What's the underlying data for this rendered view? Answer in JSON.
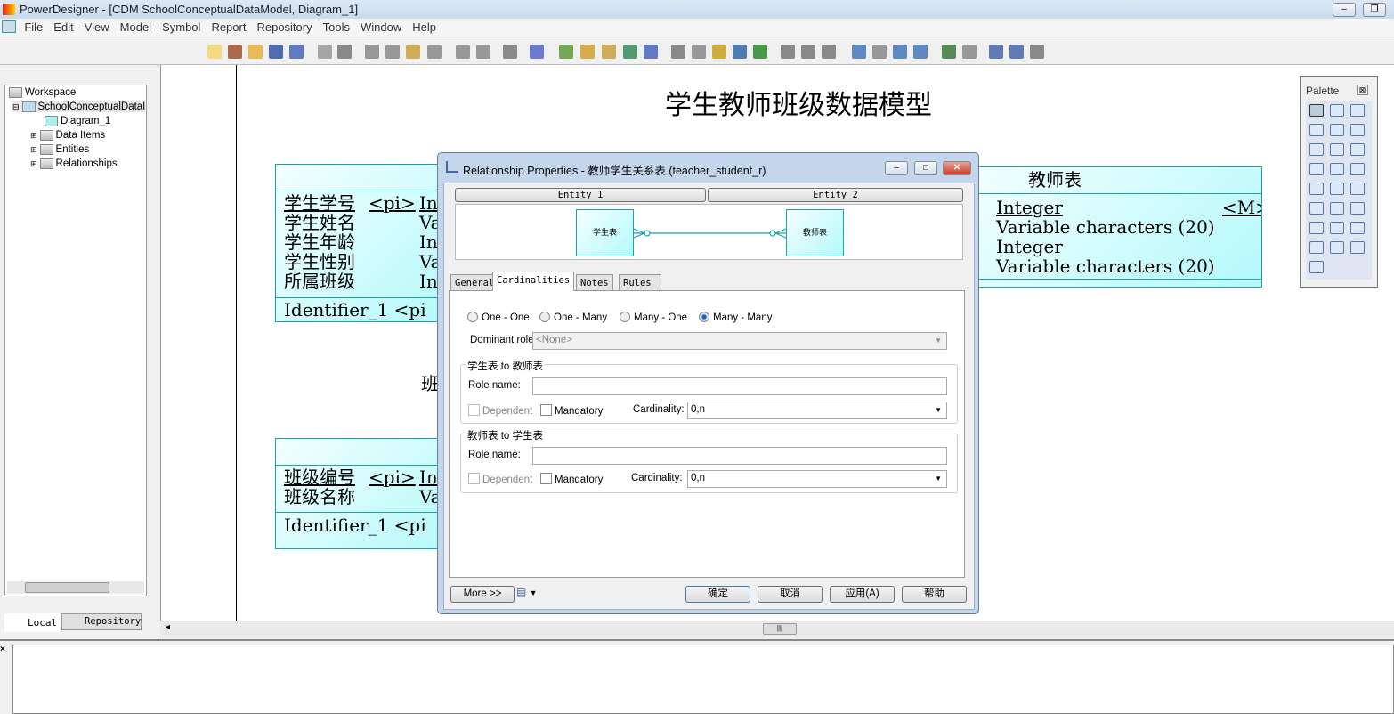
{
  "window": {
    "title": "PowerDesigner - [CDM SchoolConceptualDataModel, Diagram_1]"
  },
  "menu": [
    "File",
    "Edit",
    "View",
    "Model",
    "Symbol",
    "Report",
    "Repository",
    "Tools",
    "Window",
    "Help"
  ],
  "browser": {
    "tree": [
      {
        "label": "Workspace"
      },
      {
        "label": "SchoolConceptualDataI"
      },
      {
        "label": "Diagram_1"
      },
      {
        "label": "Data Items"
      },
      {
        "label": "Entities"
      },
      {
        "label": "Relationships"
      }
    ],
    "tabs": [
      "Local",
      "Repository"
    ]
  },
  "diagram": {
    "title": "学生教师班级数据模型",
    "student": {
      "attrs": [
        {
          "name": "学生学号",
          "pi": "<pi>",
          "type": "In"
        },
        {
          "name": "学生姓名",
          "type": "Va"
        },
        {
          "name": "学生年龄",
          "type": "In"
        },
        {
          "name": "学生性别",
          "type": "Va"
        },
        {
          "name": "所属班级",
          "type": "In"
        }
      ],
      "identifier": "Identifier_1 <pi"
    },
    "class": {
      "attrs": [
        {
          "name": "班级编号",
          "pi": "<pi>",
          "type": "In"
        },
        {
          "name": "班级名称",
          "type": "Va"
        }
      ],
      "identifier": "Identifier_1 <pi"
    },
    "class_rel_label": "班",
    "teacher": {
      "title": "教师表",
      "types": [
        "Integer",
        "Variable characters (20)",
        "Integer",
        "Variable characters (20)"
      ],
      "mandatory": "<M>"
    }
  },
  "palette": {
    "title": "Palette"
  },
  "dialog": {
    "title": "Relationship Properties - 教师学生关系表 (teacher_student_r)",
    "entity1_btn": "Entity 1",
    "entity2_btn": "Entity 2",
    "entity1": "学生表",
    "entity2": "教师表",
    "tabs": [
      "General",
      "Cardinalities",
      "Notes",
      "Rules"
    ],
    "active_tab": "Cardinalities",
    "radios": [
      "One - One",
      "One - Many",
      "Many - One",
      "Many - Many"
    ],
    "selected": "Many - Many",
    "dominant_label": "Dominant role:",
    "dominant_value": "<None>",
    "group1": {
      "title": "学生表 to 教师表",
      "role_label": "Role name:",
      "role_value": "",
      "dependent": "Dependent",
      "mandatory": "Mandatory",
      "card_label": "Cardinality:",
      "card_value": "0,n"
    },
    "group2": {
      "title": "教师表 to 学生表",
      "role_label": "Role name:",
      "role_value": "",
      "dependent": "Dependent",
      "mandatory": "Mandatory",
      "card_label": "Cardinality:",
      "card_value": "0,n"
    },
    "more": "More >>",
    "ok": "确定",
    "cancel": "取消",
    "apply": "应用(A)",
    "help": "帮助"
  },
  "colors": {
    "entity_border": "#1aa5a5",
    "entity_fill": "#b4f9fb"
  }
}
